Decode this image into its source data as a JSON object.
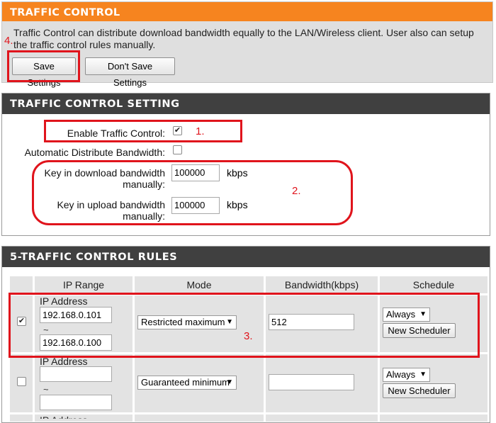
{
  "section1": {
    "title": "TRAFFIC CONTROL",
    "description": "Traffic Control can distribute download bandwidth equally to the LAN/Wireless client. User also can setup the traffic control rules manually.",
    "save_label": "Save Settings",
    "dont_save_label": "Don't Save Settings"
  },
  "section2": {
    "title": "TRAFFIC CONTROL SETTING",
    "enable_label": "Enable Traffic Control:",
    "enable_checked": true,
    "auto_label": "Automatic Distribute Bandwidth:",
    "auto_checked": false,
    "download_label_1": "Key in download bandwidth",
    "download_label_2": "manually:",
    "download_value": "100000",
    "upload_label_1": "Key in upload bandwidth",
    "upload_label_2": "manually:",
    "upload_value": "100000",
    "unit": "kbps"
  },
  "section3": {
    "title": "5-TRAFFIC CONTROL RULES",
    "columns": [
      "IP Range",
      "Mode",
      "Bandwidth(kbps)",
      "Schedule"
    ],
    "rows": [
      {
        "checked": true,
        "ip_label": "IP Address",
        "ip_start": "192.168.0.101",
        "tilde": "~",
        "ip_end": "192.168.0.100",
        "mode": "Restricted maximum",
        "bandwidth": "512",
        "schedule": "Always",
        "scheduler_button": "New Scheduler"
      },
      {
        "checked": false,
        "ip_label": "IP Address",
        "ip_start": "",
        "tilde": "~",
        "ip_end": "",
        "mode": "Guaranteed minimum",
        "bandwidth": "",
        "schedule": "Always",
        "scheduler_button": "New Scheduler"
      },
      {
        "ip_label": "IP Address"
      }
    ]
  },
  "annotations": {
    "n1": "1.",
    "n2": "2.",
    "n3": "3.",
    "n4": "4."
  },
  "colors": {
    "orange_header": "#f6841f",
    "dark_header": "#404040",
    "annotation_red": "#e0141c"
  }
}
